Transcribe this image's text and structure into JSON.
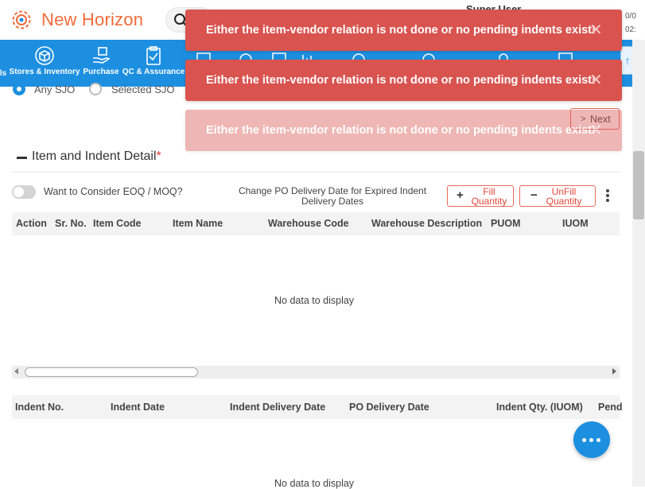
{
  "header": {
    "brand": "New Horizon",
    "user_name": "Super User",
    "user_meta_1": "0/0",
    "user_meta_2": "02:"
  },
  "modules": [
    {
      "label": "ls",
      "icon": "edit-icon"
    },
    {
      "label": "Stores & Inventory",
      "icon": "box-icon"
    },
    {
      "label": "Purchase",
      "icon": "hand-box-icon"
    },
    {
      "label": "QC & Assurance",
      "icon": "checklist-icon"
    }
  ],
  "source_filter": {
    "any_sjo": "Any SJO",
    "selected_sjo": "Selected SJO",
    "selected": "any_sjo"
  },
  "next_button": "Next",
  "section": {
    "title": "Item and Indent Detail",
    "required_mark": "*"
  },
  "eoq_toggle": {
    "label": "Want to Consider EOQ / MOQ?",
    "on": false
  },
  "change_po_date_label": "Change PO Delivery Date for Expired Indent Delivery Dates",
  "fill_quantity_btn": "Fill Quantity",
  "unfill_quantity_btn": "UnFill Quantity",
  "item_table": {
    "columns": [
      "Action",
      "Sr. No.",
      "Item Code",
      "Item Name",
      "Warehouse Code",
      "Warehouse Description",
      "PUOM",
      "IUOM"
    ],
    "empty_text": "No data to display"
  },
  "indent_table": {
    "columns": [
      "Indent No.",
      "Indent Date",
      "Indent Delivery Date",
      "PO Delivery Date",
      "Indent Qty. (IUOM)",
      "Pend"
    ],
    "empty_text": "No data to display"
  },
  "toasts": [
    {
      "message": "Either the item-vendor relation is not done or no pending indents exist!"
    },
    {
      "message": "Either the item-vendor relation is not done or no pending indents exist!"
    },
    {
      "message": "Either the item-vendor relation is not done or no pending indents exist!"
    }
  ],
  "colors": {
    "brand": "#f26b3a",
    "nav": "#1d8fe0",
    "toast": "#d9534f",
    "accent_button_border": "#e86b5a"
  }
}
